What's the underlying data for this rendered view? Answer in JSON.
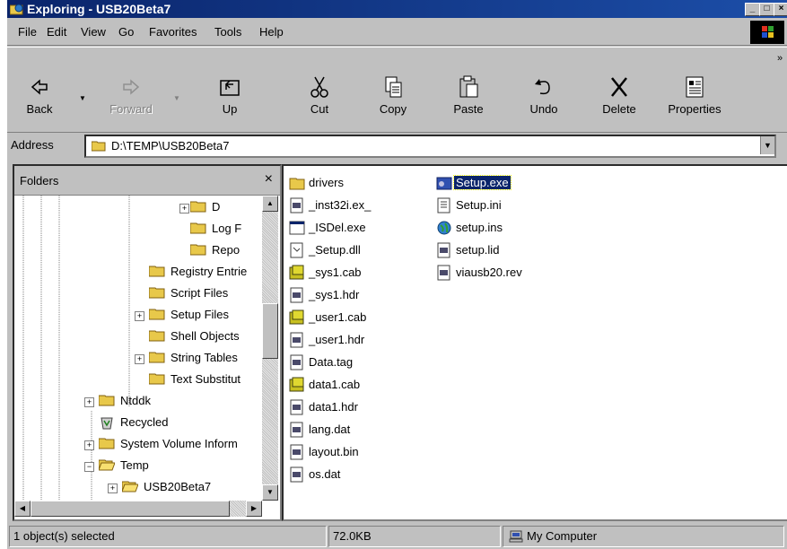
{
  "window": {
    "title": "Exploring - USB20Beta7",
    "min_label": "_",
    "max_label": "□",
    "close_label": "×"
  },
  "menu": [
    "File",
    "Edit",
    "View",
    "Go",
    "Favorites",
    "Tools",
    "Help"
  ],
  "toolbar": {
    "back": "Back",
    "forward": "Forward",
    "up": "Up",
    "cut": "Cut",
    "copy": "Copy",
    "paste": "Paste",
    "undo": "Undo",
    "delete": "Delete",
    "properties": "Properties"
  },
  "address": {
    "label": "Address",
    "value": "D:\\TEMP\\USB20Beta7"
  },
  "folders_pane": {
    "title": "Folders",
    "close": "×",
    "tree": [
      {
        "name": "D",
        "toggle": "+"
      },
      {
        "name": "Log F",
        "toggle": ""
      },
      {
        "name": "Repo",
        "toggle": ""
      },
      {
        "name": "Registry Entrie",
        "toggle": ""
      },
      {
        "name": "Script Files",
        "toggle": ""
      },
      {
        "name": "Setup Files",
        "toggle": "+"
      },
      {
        "name": "Shell Objects",
        "toggle": ""
      },
      {
        "name": "String Tables",
        "toggle": "+"
      },
      {
        "name": "Text Substitut",
        "toggle": ""
      },
      {
        "name": "Ntddk",
        "toggle": "+"
      },
      {
        "name": "Recycled",
        "toggle": ""
      },
      {
        "name": "System Volume Inform",
        "toggle": "+"
      },
      {
        "name": "Temp",
        "toggle": "−"
      },
      {
        "name": "USB20Beta7",
        "toggle": "+"
      }
    ]
  },
  "files": {
    "col1": [
      "drivers",
      "_inst32i.ex_",
      "_ISDel.exe",
      "_Setup.dll",
      "_sys1.cab",
      "_sys1.hdr",
      "_user1.cab",
      "_user1.hdr",
      "Data.tag",
      "data1.cab",
      "data1.hdr",
      "lang.dat",
      "layout.bin",
      "os.dat"
    ],
    "col2": [
      "Setup.exe",
      "Setup.ini",
      "setup.ins",
      "setup.lid",
      "viausb20.rev"
    ],
    "selected": "Setup.exe"
  },
  "status": {
    "selection": "1 object(s) selected",
    "size": "72.0KB",
    "location": "My Computer"
  }
}
